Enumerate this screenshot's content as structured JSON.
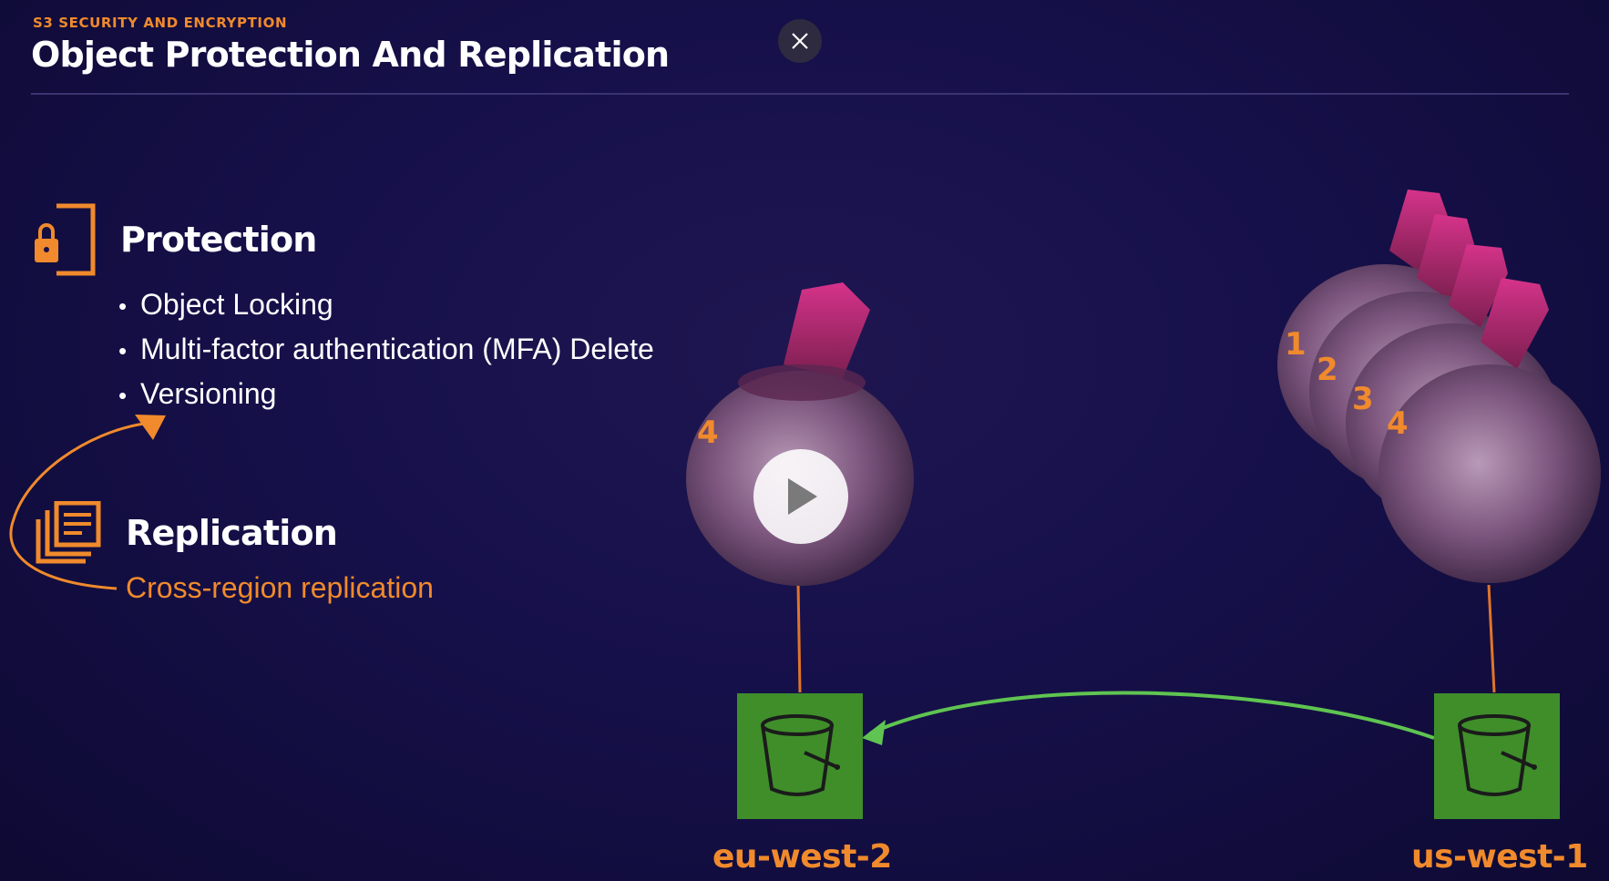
{
  "header": {
    "eyebrow": "S3 SECURITY AND ENCRYPTION",
    "title": "Object Protection And Replication",
    "close_icon": "close-icon"
  },
  "protection": {
    "icon": "lock-icon",
    "heading": "Protection",
    "items": [
      "Object Locking",
      "Multi-factor authentication (MFA) Delete",
      "Versioning"
    ]
  },
  "replication": {
    "icon": "documents-icon",
    "heading": "Replication",
    "subtitle": "Cross-region replication"
  },
  "diagram": {
    "destination": {
      "region": "eu-west-2",
      "version_label": "4"
    },
    "source": {
      "region": "us-west-1",
      "version_labels": [
        "1",
        "2",
        "3",
        "4"
      ]
    },
    "bucket_icon": "bucket-icon",
    "play_icon": "play-icon"
  },
  "colors": {
    "accent": "#f08a2c",
    "bucket": "#3f8e2a",
    "arrow": "#5fc451",
    "background": "#16104a"
  }
}
